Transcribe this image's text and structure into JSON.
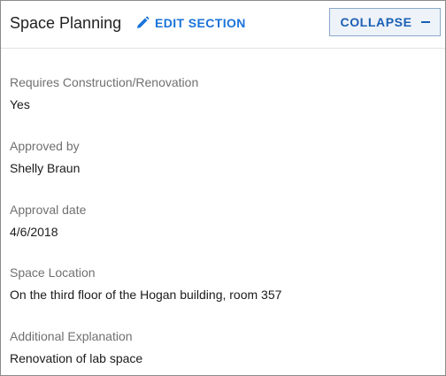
{
  "section": {
    "title": "Space Planning",
    "edit_label": "EDIT SECTION",
    "collapse_label": "COLLAPSE"
  },
  "fields": [
    {
      "label": "Requires Construction/Renovation",
      "value": "Yes"
    },
    {
      "label": "Approved by",
      "value": "Shelly Braun"
    },
    {
      "label": "Approval date",
      "value": "4/6/2018"
    },
    {
      "label": "Space Location",
      "value": "On the third floor of the Hogan building, room 357"
    },
    {
      "label": "Additional Explanation",
      "value": "Renovation of lab space"
    }
  ],
  "colors": {
    "accent": "#1a73d9",
    "label_text": "#707070",
    "value_text": "#1b1b1b",
    "border": "#8a8a8a"
  },
  "icons": {
    "edit": "pencil-icon",
    "collapse": "minus-icon"
  }
}
